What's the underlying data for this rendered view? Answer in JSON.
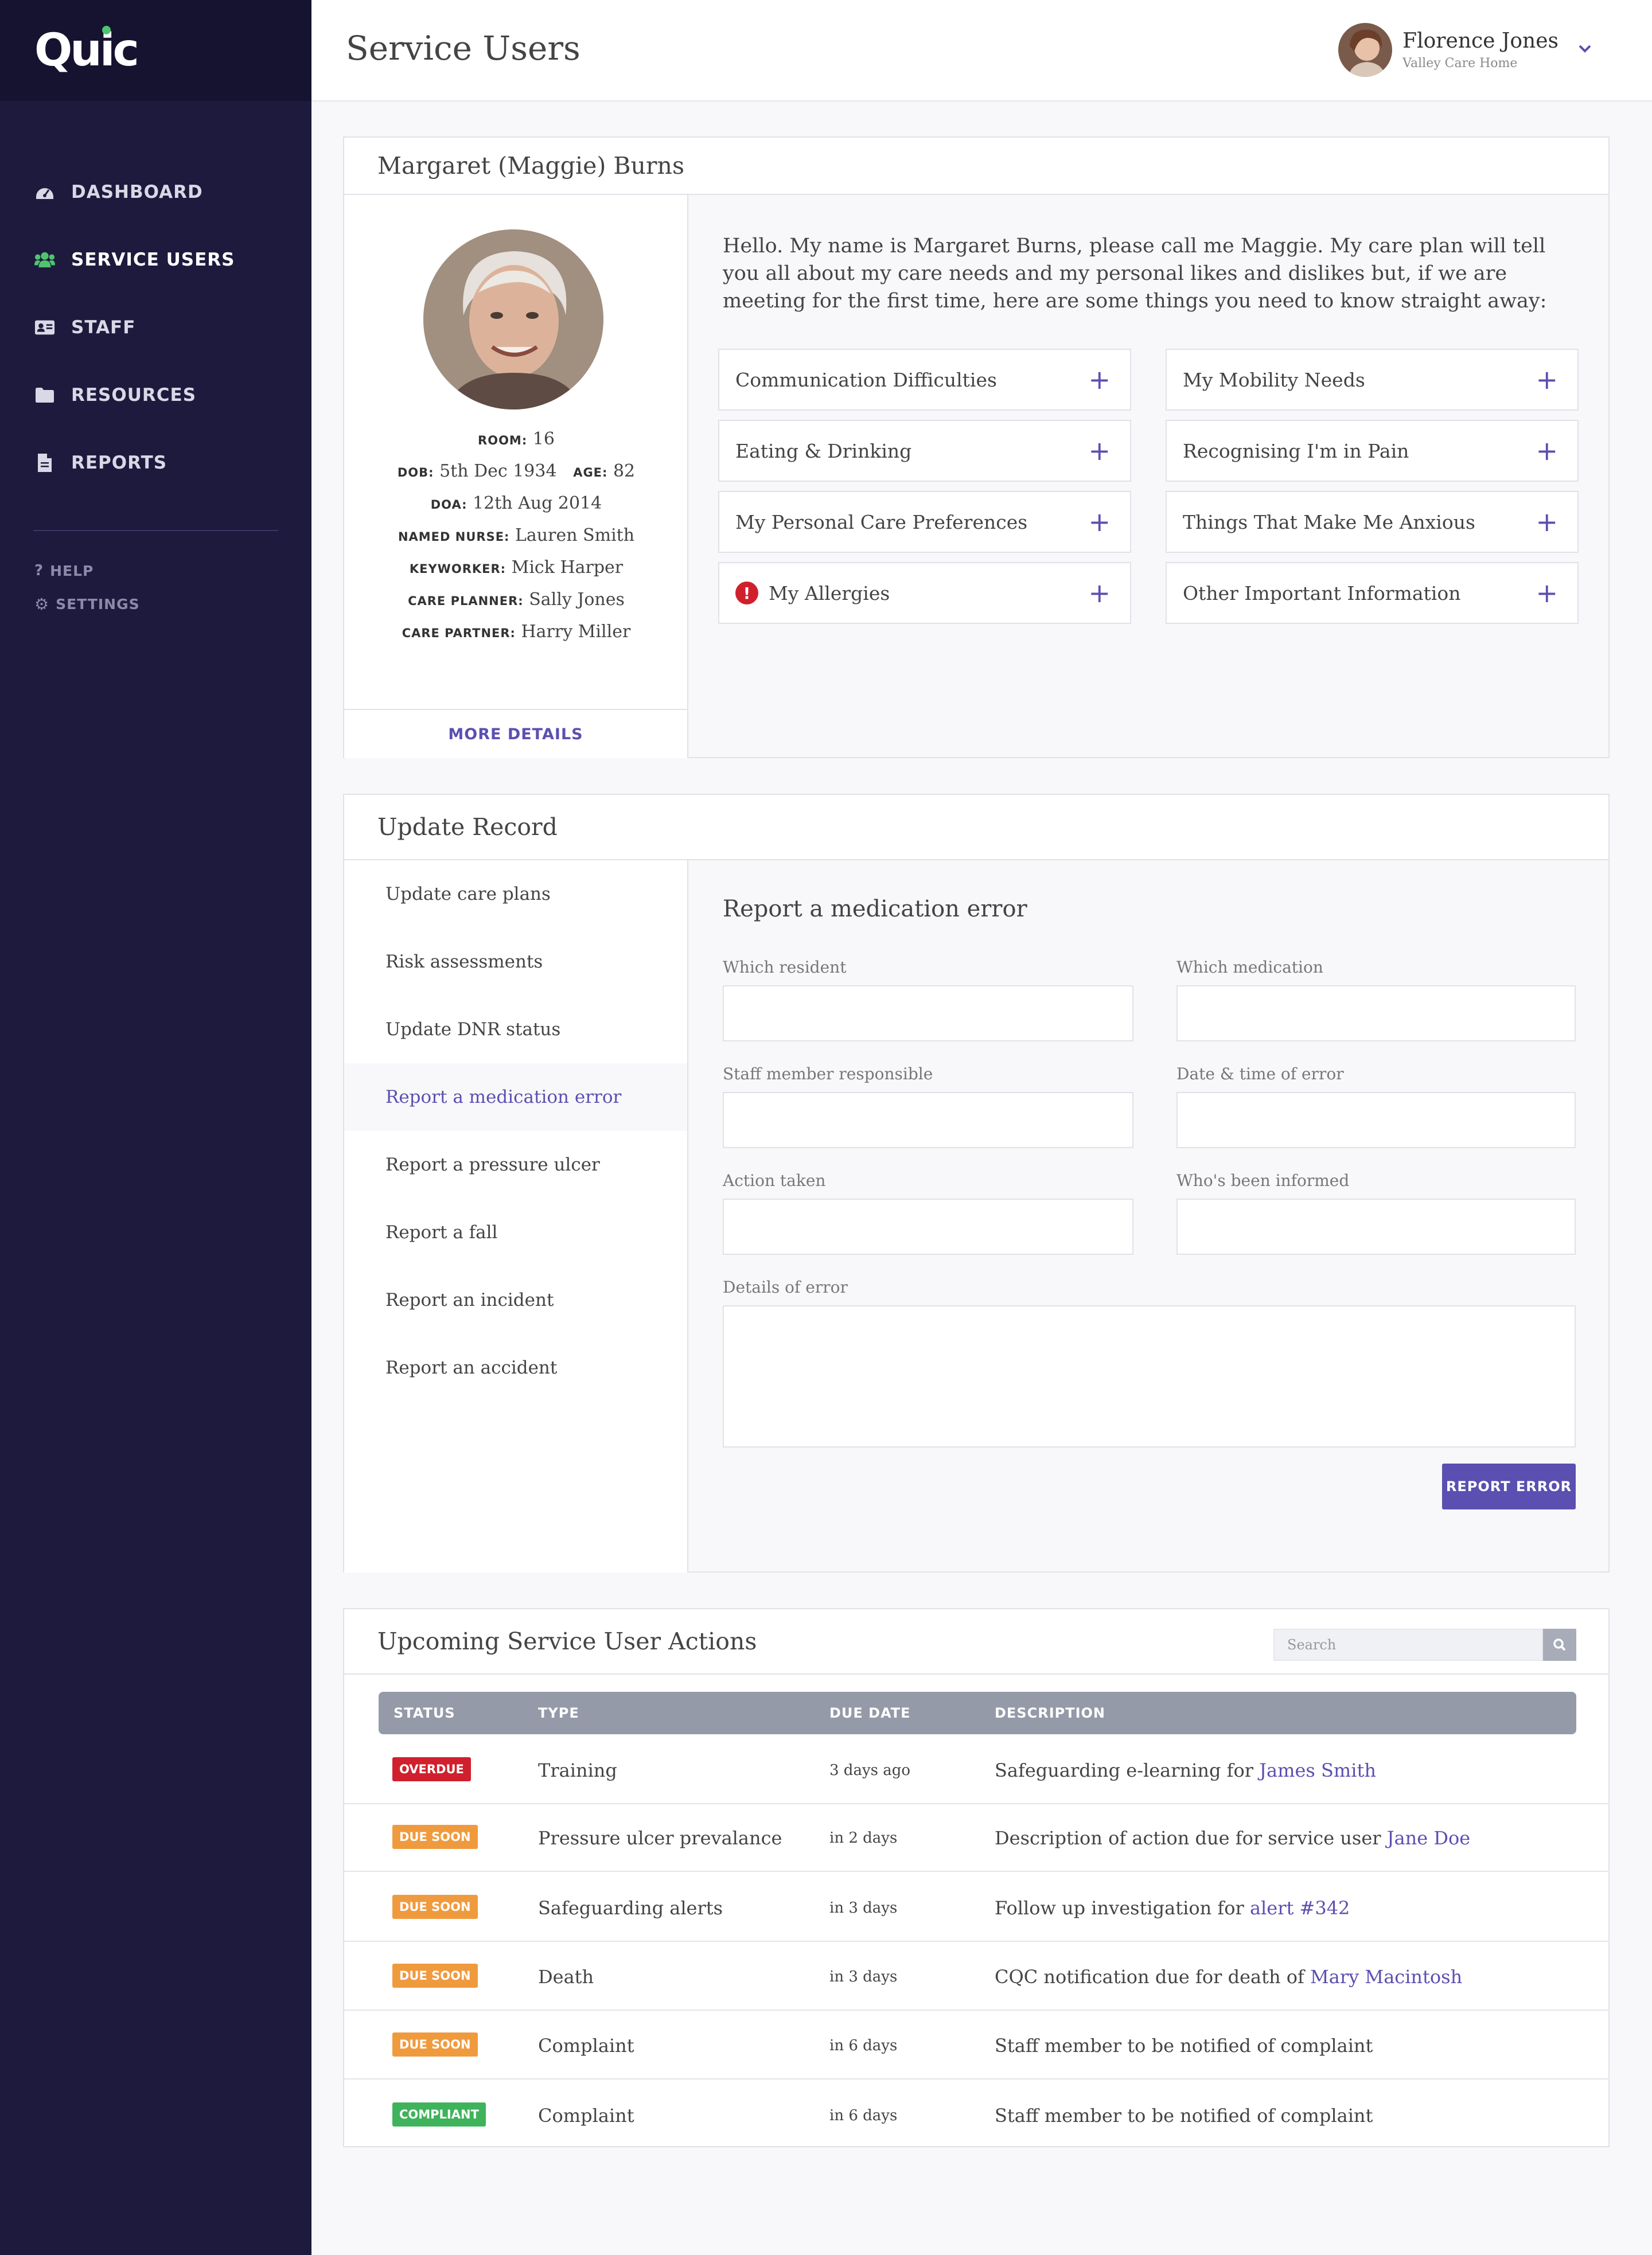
{
  "app": {
    "logo": "Quic"
  },
  "sidebar": {
    "items": [
      {
        "label": "DASHBOARD",
        "icon": "dashboard-icon"
      },
      {
        "label": "SERVICE USERS",
        "icon": "users-icon",
        "active": true
      },
      {
        "label": "STAFF",
        "icon": "id-card-icon"
      },
      {
        "label": "RESOURCES",
        "icon": "folder-icon"
      },
      {
        "label": "REPORTS",
        "icon": "file-icon"
      }
    ],
    "help": "HELP",
    "settings": "SETTINGS"
  },
  "header": {
    "title": "Service Users",
    "user_name": "Florence Jones",
    "user_org": "Valley Care Home"
  },
  "profile": {
    "name": "Margaret (Maggie) Burns",
    "room_k": "ROOM:",
    "room": "16",
    "dob_k": "DOB:",
    "dob": "5th Dec 1934",
    "age_k": "AGE:",
    "age": "82",
    "doa_k": "DOA:",
    "doa": "12th Aug 2014",
    "nurse_k": "NAMED NURSE:",
    "nurse": "Lauren Smith",
    "keyworker_k": "KEYWORKER:",
    "keyworker": "Mick Harper",
    "planner_k": "CARE PLANNER:",
    "planner": "Sally Jones",
    "partner_k": "CARE PARTNER:",
    "partner": "Harry Miller",
    "more": "MORE DETAILS",
    "intro": "Hello. My name is Margaret Burns, please call me Maggie. My care plan will tell you all about my care needs and my personal likes and dislikes but, if we are meeting for the first time, here are some things you need to know straight away:",
    "sections": [
      "Communication Difficulties",
      "My Mobility Needs",
      "Eating & Drinking",
      "Recognising I'm in Pain",
      "My Personal Care Preferences",
      "Things That Make Me Anxious",
      "My Allergies",
      "Other Important Information"
    ]
  },
  "update": {
    "title": "Update Record",
    "menu": [
      "Update care plans",
      "Risk assessments",
      "Update DNR status",
      "Report a medication error",
      "Report a pressure ulcer",
      "Report a fall",
      "Report an incident",
      "Report an accident"
    ],
    "form_title": "Report a medication error",
    "fields": {
      "resident": "Which resident",
      "medication": "Which medication",
      "staff": "Staff member responsible",
      "datetime": "Date & time of error",
      "action": "Action taken",
      "informed": "Who's been informed",
      "details": "Details of error"
    },
    "submit": "REPORT ERROR"
  },
  "actions": {
    "title": "Upcoming Service User Actions",
    "search_placeholder": "Search",
    "columns": [
      "STATUS",
      "TYPE",
      "DUE DATE",
      "DESCRIPTION"
    ],
    "rows": [
      {
        "status": "OVERDUE",
        "status_color": "#d0202d",
        "type": "Training",
        "due": "3 days ago",
        "desc": "Safeguarding e-learning for ",
        "link": "James Smith"
      },
      {
        "status": "DUE SOON",
        "status_color": "#f09a3e",
        "type": "Pressure ulcer prevalance",
        "due": "in 2 days",
        "desc": "Description of action due for service user ",
        "link": "Jane Doe"
      },
      {
        "status": "DUE SOON",
        "status_color": "#f09a3e",
        "type": "Safeguarding alerts",
        "due": "in 3 days",
        "desc": "Follow up investigation for ",
        "link": "alert #342"
      },
      {
        "status": "DUE SOON",
        "status_color": "#f09a3e",
        "type": "Death",
        "due": "in 3 days",
        "desc": "CQC notification due for death of ",
        "link": "Mary Macintosh"
      },
      {
        "status": "DUE SOON",
        "status_color": "#f09a3e",
        "type": "Complaint",
        "due": "in 6 days",
        "desc": "Staff member to be notified of complaint",
        "link": ""
      },
      {
        "status": "COMPLIANT",
        "status_color": "#3fb35c",
        "type": "Complaint",
        "due": "in 6 days",
        "desc": "Staff member to be notified of complaint",
        "link": ""
      }
    ]
  },
  "colors": {
    "accent": "#5b4fb1",
    "sidebar": "#1d1a3d",
    "active_icon": "#4fc46f"
  }
}
